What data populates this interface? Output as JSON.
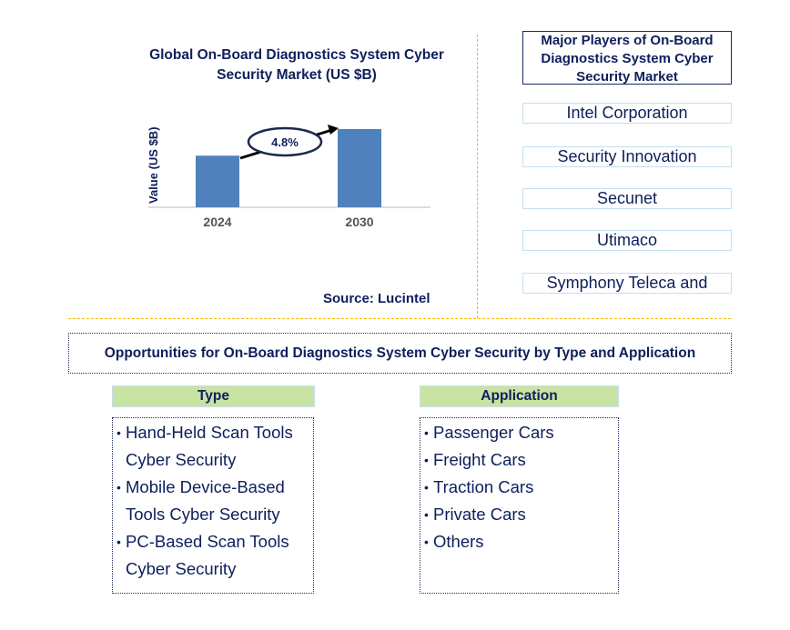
{
  "chart_data": {
    "type": "bar",
    "title": "Global On-Board Diagnostics System Cyber Security Market (US $B)",
    "categories": [
      "2024",
      "2030"
    ],
    "values": [
      0.66,
      1.0
    ],
    "value_note": "relative heights only; no numeric axis shown",
    "xlabel": "",
    "ylabel": "Value (US $B)",
    "grid": false,
    "annotation": {
      "label": "4.8%",
      "meaning": "CAGR 2024-2030",
      "from": "2024",
      "to": "2030"
    },
    "colors": {
      "bar": "#4f81bd",
      "title": "#0d1f5c",
      "tick": "#555555",
      "annotation_border": "#1a2a4c"
    }
  },
  "source": "Source: Lucintel",
  "players": {
    "title": "Major Players of On-Board Diagnostics System Cyber Security Market",
    "items": [
      "Intel Corporation",
      "Security Innovation",
      "Secunet",
      "Utimaco",
      "Symphony Teleca and"
    ]
  },
  "opportunities": {
    "title": "Opportunities for On-Board Diagnostics System Cyber Security by Type and Application",
    "type": {
      "header": "Type",
      "items": [
        "Hand-Held Scan Tools Cyber Security",
        "Mobile Device-Based Tools Cyber Security",
        "PC-Based Scan Tools Cyber Security"
      ]
    },
    "application": {
      "header": "Application",
      "items": [
        "Passenger Cars",
        "Freight Cars",
        "Traction Cars",
        "Private Cars",
        "Others"
      ]
    }
  },
  "colors": {
    "divider": "#f5b800",
    "header_green": "#c9e3a2",
    "text_navy": "#0d1f5c"
  }
}
